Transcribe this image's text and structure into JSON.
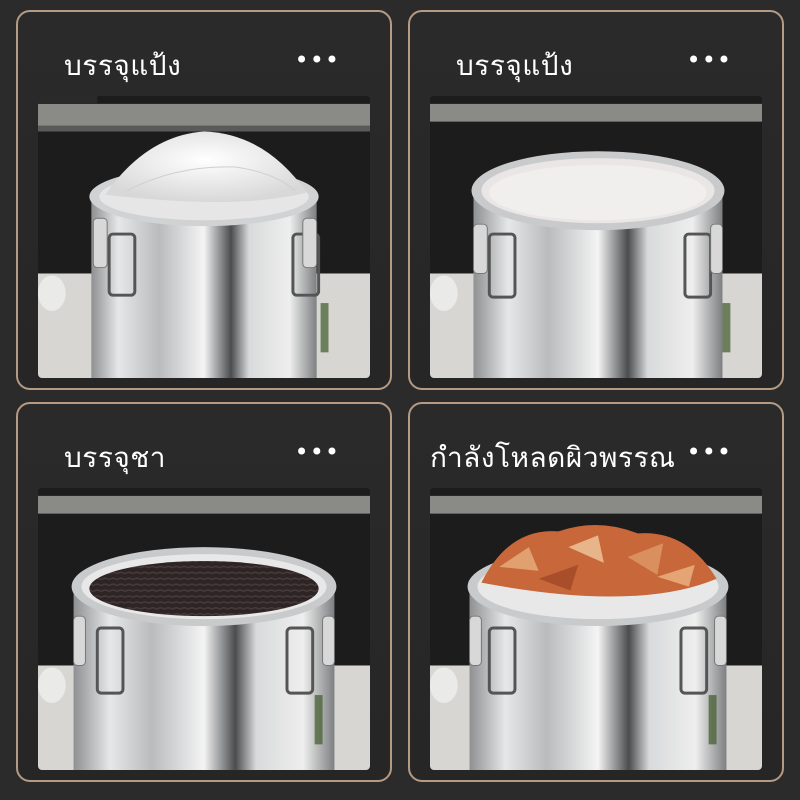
{
  "cards": [
    {
      "title": "บรรจุแป้ง",
      "more": "•••",
      "content": "flour",
      "fill_color": "#f2f2f2"
    },
    {
      "title": "บรรจุแป้ง",
      "more": "•••",
      "content": "rice",
      "fill_color": "#e8e4e4"
    },
    {
      "title": "บรรจุชา",
      "more": "•••",
      "content": "tea",
      "fill_color": "#2e2626"
    },
    {
      "title": "กำลังโหลดผิวพรรณ",
      "more": "•••",
      "content": "peel",
      "fill_color": "#c8673a"
    }
  ],
  "colors": {
    "background": "#2b2b2b",
    "card_border": "#b59a84",
    "steel": "#c9cbcd"
  }
}
